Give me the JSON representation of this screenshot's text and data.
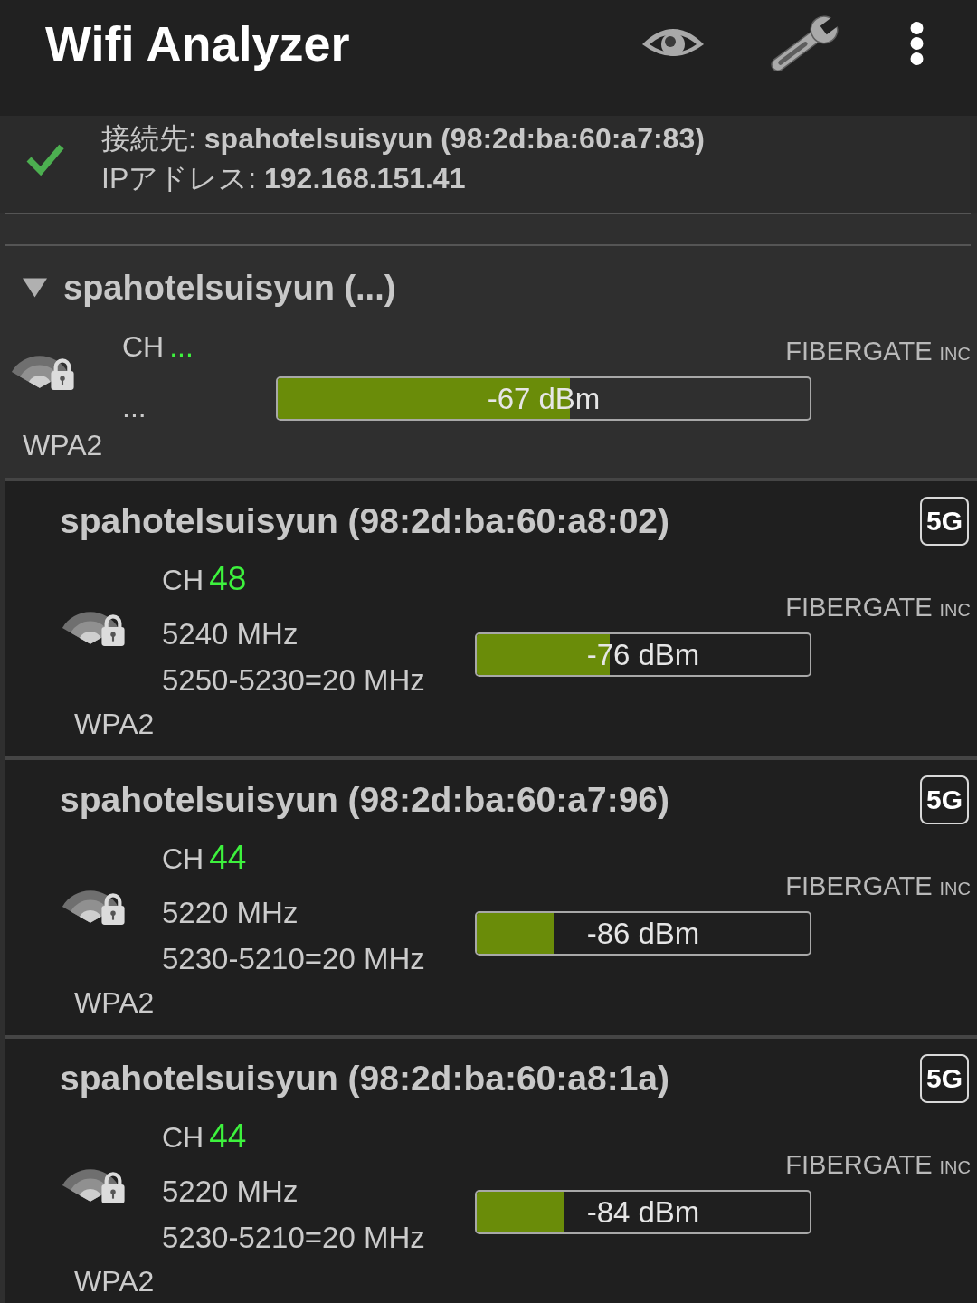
{
  "app_bar": {
    "title": "Wifi Analyzer"
  },
  "connection": {
    "connected": true,
    "connected_to": "接続先: **spahotelsuisyun (98:2d:ba:60:a7:83)**",
    "ip_address": "IPアドレス: **192.168.151.41**"
  },
  "groups": [
    {
      "title": "spahotelsuisyun (...)",
      "expanded": true,
      "channel_label": "CH",
      "channel": "...",
      "frequency": "...",
      "security": "WPA2",
      "vendor": "FIBERGATE",
      "vendor_suffix": "INC",
      "signal": {
        "level": 0.55,
        "reading": "-67 dBm"
      },
      "networks": [
        {
          "ssid": "spahotelsuisyun (98:2d:ba:60:a8:02)",
          "band": "5G",
          "channel_label": "CH",
          "channel": "48",
          "frequency": "5240 MHz",
          "bandwidth": "5250-5230=20 MHz",
          "security": "WPA2",
          "vendor": "FIBERGATE",
          "vendor_suffix": "INC",
          "signal": {
            "level": 0.4,
            "reading": "-76 dBm"
          }
        },
        {
          "ssid": "spahotelsuisyun (98:2d:ba:60:a7:96)",
          "band": "5G",
          "channel_label": "CH",
          "channel": "44",
          "frequency": "5220 MHz",
          "bandwidth": "5230-5210=20 MHz",
          "security": "WPA2",
          "vendor": "FIBERGATE",
          "vendor_suffix": "INC",
          "signal": {
            "level": 0.23,
            "reading": "-86 dBm"
          }
        },
        {
          "ssid": "spahotelsuisyun (98:2d:ba:60:a8:1a)",
          "band": "5G",
          "channel_label": "CH",
          "channel": "44",
          "frequency": "5220 MHz",
          "bandwidth": "5230-5210=20 MHz",
          "security": "WPA2",
          "vendor": "FIBERGATE",
          "vendor_suffix": "INC",
          "signal": {
            "level": 0.26,
            "reading": "-84 dBm"
          }
        }
      ]
    }
  ]
}
